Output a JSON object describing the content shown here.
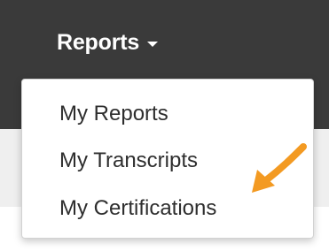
{
  "nav": {
    "reports_label": "Reports",
    "caret_icon": "caret-down-icon"
  },
  "dropdown": {
    "items": [
      {
        "label": "My Reports"
      },
      {
        "label": "My Transcripts"
      },
      {
        "label": "My Certifications"
      }
    ]
  },
  "annotation": {
    "arrow_icon": "pointer-arrow-icon",
    "arrow_color": "#f39a22",
    "points_to": "My Certifications"
  },
  "colors": {
    "topbar": "#3a3a3a",
    "subbar": "#efefef",
    "dropdown_bg": "#ffffff",
    "menu_text": "#2e2e2e",
    "nav_text": "#ffffff"
  }
}
